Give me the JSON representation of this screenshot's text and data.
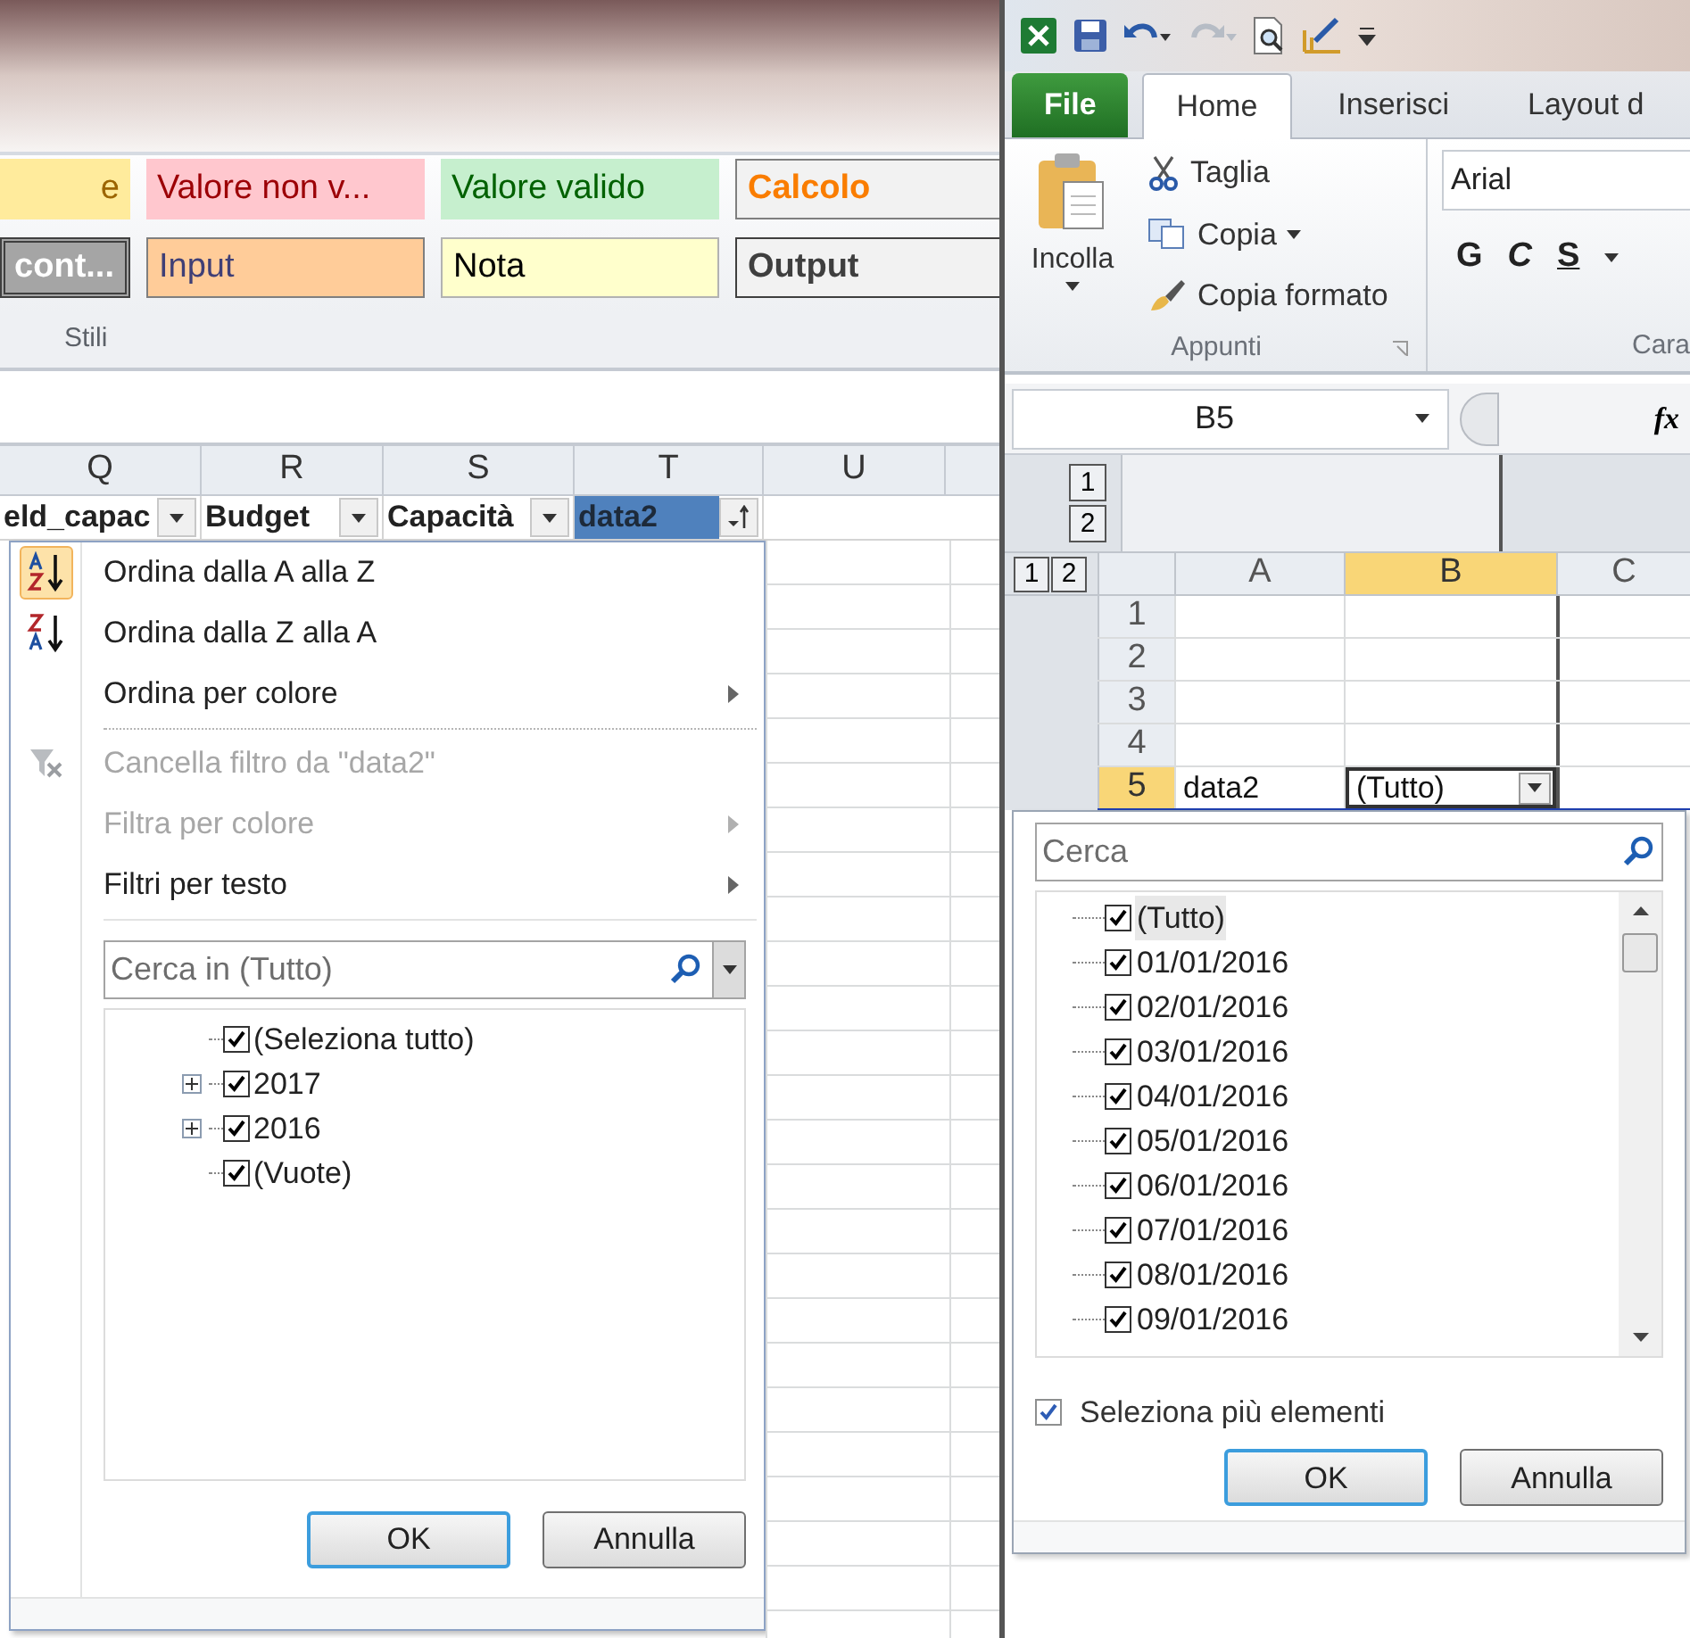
{
  "left": {
    "cell_styles": [
      {
        "label": "e",
        "kind": "neutral"
      },
      {
        "label": "Valore non v...",
        "kind": "bad"
      },
      {
        "label": "Valore valido",
        "kind": "good"
      },
      {
        "label": "Calcolo",
        "kind": "calculation"
      },
      {
        "label": "cont...",
        "kind": "check"
      },
      {
        "label": "Input",
        "kind": "input"
      },
      {
        "label": "Nota",
        "kind": "note"
      },
      {
        "label": "Output",
        "kind": "output"
      }
    ],
    "group_label": "Stili",
    "columns": [
      "Q",
      "R",
      "S",
      "T",
      "U"
    ],
    "header_cells": [
      {
        "text": "eld_capac",
        "selected": false,
        "sorted": false
      },
      {
        "text": "Budget",
        "selected": false,
        "sorted": false
      },
      {
        "text": "Capacità",
        "selected": false,
        "sorted": false
      },
      {
        "text": "data2",
        "selected": true,
        "sorted": true
      }
    ],
    "filter_menu": {
      "items": [
        {
          "kind": "sort_az",
          "label": "Ordina dalla A alla Z",
          "disabled": false,
          "submenu": false,
          "highlighted": true
        },
        {
          "kind": "sort_za",
          "label": "Ordina dalla Z alla A",
          "disabled": false,
          "submenu": false,
          "highlighted": false
        },
        {
          "kind": "plain",
          "label": "Ordina per colore",
          "disabled": false,
          "submenu": true,
          "highlighted": false
        },
        {
          "kind": "dotted_separator"
        },
        {
          "kind": "clear_filter",
          "label": "Cancella filtro da \"data2\"",
          "disabled": true,
          "submenu": false,
          "highlighted": false
        },
        {
          "kind": "plain",
          "label": "Filtra per colore",
          "disabled": true,
          "submenu": true,
          "highlighted": false
        },
        {
          "kind": "plain",
          "label": "Filtri per testo",
          "disabled": false,
          "submenu": true,
          "highlighted": false
        },
        {
          "kind": "solid_separator"
        }
      ],
      "search": {
        "placeholder": "Cerca in (Tutto)"
      },
      "tree": [
        {
          "label": "(Seleziona tutto)",
          "checked": true
        },
        {
          "label": "2017",
          "checked": true,
          "expanded": false
        },
        {
          "label": "2016",
          "checked": true,
          "expanded": false
        },
        {
          "label": "(Vuote)",
          "checked": true
        }
      ],
      "buttons": [
        {
          "label": "OK",
          "default": true
        },
        {
          "label": "Annulla",
          "default": false
        }
      ]
    }
  },
  "right": {
    "tabs": [
      {
        "label": "File",
        "kind": "file",
        "selected": false
      },
      {
        "label": "Home",
        "kind": "tab",
        "selected": true
      },
      {
        "label": "Inserisci",
        "kind": "tab",
        "selected": false
      },
      {
        "label": "Layout d",
        "kind": "tab",
        "selected": false
      }
    ],
    "clipboard": {
      "paste": "Incolla",
      "cut": "Taglia",
      "copy": "Copia",
      "format_painter": "Copia formato",
      "label": "Appunti"
    },
    "font": {
      "font_name": "Arial",
      "buttons": [
        "G",
        "C",
        "S"
      ],
      "label": "Cara"
    },
    "name_box": "B5",
    "function_label": "fx",
    "row_levels": [
      "1",
      "2"
    ],
    "column_levels": [
      "1",
      "2"
    ],
    "columns": [
      {
        "label": "A",
        "selected": false
      },
      {
        "label": "B",
        "selected": true
      },
      {
        "label": "C",
        "selected": false
      }
    ],
    "rows": [
      {
        "label": "1",
        "selected": false,
        "cells": []
      },
      {
        "label": "2",
        "selected": false,
        "cells": []
      },
      {
        "label": "3",
        "selected": false,
        "cells": []
      },
      {
        "label": "4",
        "selected": false,
        "cells": []
      },
      {
        "label": "5",
        "selected": true,
        "cells": [
          {
            "text": "data2",
            "dropdown": false
          },
          {
            "text": "(Tutto)",
            "dropdown": true
          }
        ]
      }
    ],
    "filter_popup": {
      "search": {
        "placeholder": "Cerca"
      },
      "items": [
        {
          "label": "(Tutto)",
          "checked": true,
          "selected": true
        },
        {
          "label": "01/01/2016",
          "checked": true,
          "selected": false
        },
        {
          "label": "02/01/2016",
          "checked": true,
          "selected": false
        },
        {
          "label": "03/01/2016",
          "checked": true,
          "selected": false
        },
        {
          "label": "04/01/2016",
          "checked": true,
          "selected": false
        },
        {
          "label": "05/01/2016",
          "checked": true,
          "selected": false
        },
        {
          "label": "06/01/2016",
          "checked": true,
          "selected": false
        },
        {
          "label": "07/01/2016",
          "checked": true,
          "selected": false
        },
        {
          "label": "08/01/2016",
          "checked": true,
          "selected": false
        },
        {
          "label": "09/01/2016",
          "checked": true,
          "selected": false
        }
      ],
      "multi_select": {
        "label": "Seleziona più elementi",
        "checked": true
      },
      "buttons": [
        {
          "label": "OK",
          "default": true
        },
        {
          "label": "Annulla",
          "default": false
        }
      ]
    }
  }
}
